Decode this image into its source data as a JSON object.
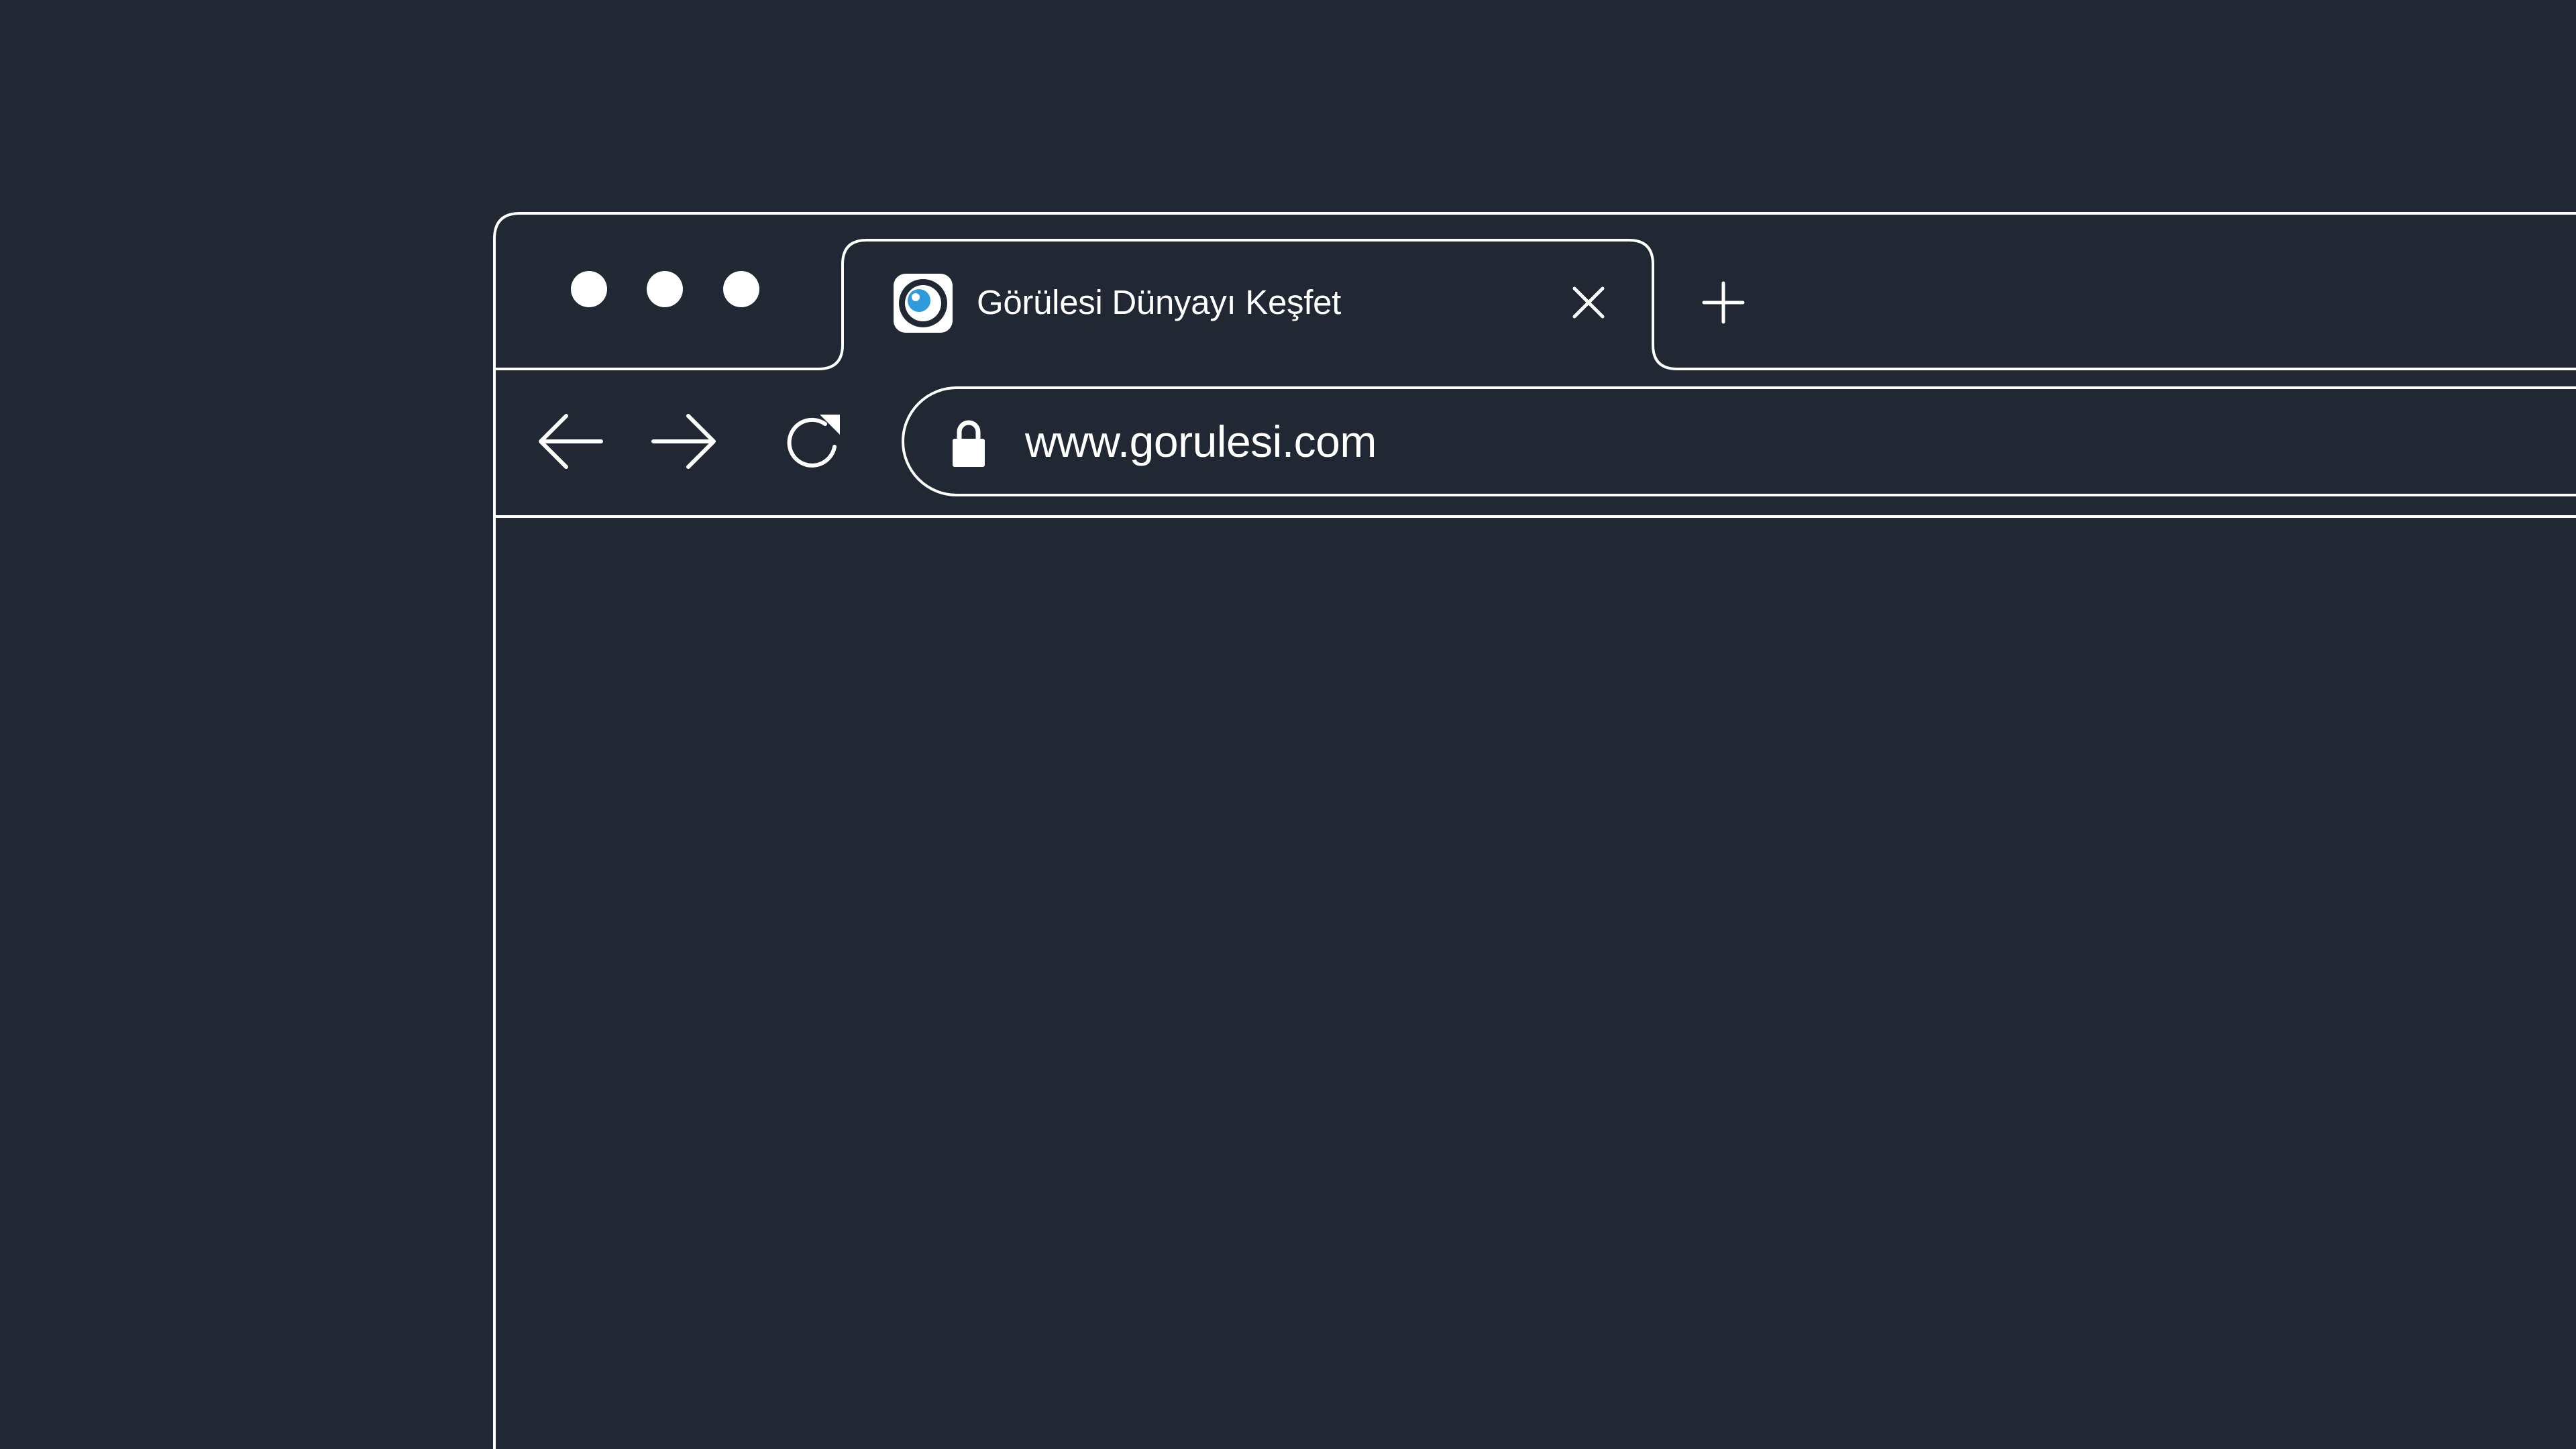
{
  "browser": {
    "window_controls": {
      "close": "close",
      "minimize": "minimize",
      "maximize": "maximize"
    },
    "tab": {
      "title": "Görülesi Dünyayı Keşfet",
      "favicon": "eye-logo-icon",
      "close_icon": "close-icon"
    },
    "new_tab_icon": "plus-icon",
    "navigation": {
      "back_icon": "arrow-left-icon",
      "forward_icon": "arrow-right-icon",
      "reload_icon": "reload-icon"
    },
    "address_bar": {
      "lock_icon": "lock-icon",
      "url": "www.gorulesi.com"
    }
  },
  "colors": {
    "background": "#222833",
    "foreground": "#ffffff",
    "favicon_accent": "#2f9bdc"
  }
}
